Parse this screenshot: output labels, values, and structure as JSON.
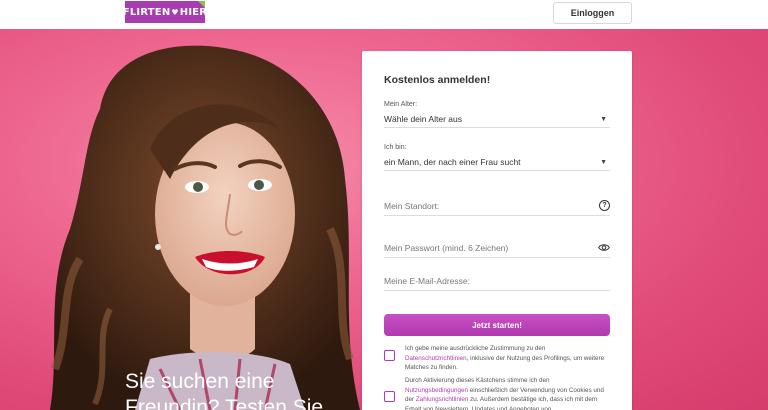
{
  "header": {
    "logo_left": "FLIRTEN",
    "logo_heart": "♥",
    "logo_right": "HIER",
    "login_label": "Einloggen"
  },
  "hero": {
    "headline_line1": "Sie suchen eine",
    "headline_line2": "Freundin? Testen Sie"
  },
  "form": {
    "title": "Kostenlos anmelden!",
    "age": {
      "label": "Mein Alter:",
      "value": "Wähle dein Alter aus"
    },
    "iam": {
      "label": "Ich bin:",
      "value": "ein Mann, der nach einer Frau sucht"
    },
    "location": {
      "placeholder": "Mein Standort:"
    },
    "password": {
      "placeholder": "Mein Passwort (mind. 6 Zeichen)"
    },
    "email": {
      "placeholder": "Meine E-Mail-Adresse:"
    },
    "submit_label": "Jetzt starten!",
    "consent1": {
      "pre": "Ich gebe meine ausdrückliche Zustimmung zu den ",
      "link": "Datenschutzrichtlinien",
      "post": ", inklusive der Nutzung des Profilings, um weitere Matches zu finden."
    },
    "consent2": {
      "pre": "Durch Aktivierung dieses Kästchens stimme ich den ",
      "link1": "Nutzungsbedingungen",
      "mid": " einschließlich der Verwendung von Cookies und der ",
      "link2": "Zahlungsrichtlinien",
      "post": " zu. Außerdem bestätige ich, dass ich mit dem Erhalt von Newslettern, Updates und Angeboten von"
    }
  },
  "colors": {
    "brand": "#a73bb0",
    "brand_accent": "#8bc34a",
    "hero_bg": "#e85a84",
    "cta": "#b23ab0"
  }
}
